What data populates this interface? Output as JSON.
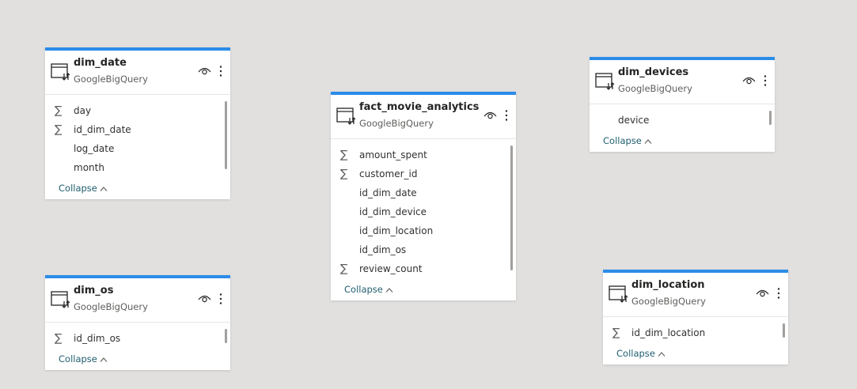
{
  "tables": {
    "dim_date": {
      "title": "dim_date",
      "source": "GoogleBigQuery",
      "collapse_label": "Collapse",
      "fields": [
        {
          "name": "day",
          "aggregate": true
        },
        {
          "name": "id_dim_date",
          "aggregate": true
        },
        {
          "name": "log_date",
          "aggregate": false
        },
        {
          "name": "month",
          "aggregate": false
        }
      ]
    },
    "fact_movie_analytics": {
      "title": "fact_movie_analytics",
      "source": "GoogleBigQuery",
      "collapse_label": "Collapse",
      "fields": [
        {
          "name": "amount_spent",
          "aggregate": true
        },
        {
          "name": "customer_id",
          "aggregate": true
        },
        {
          "name": "id_dim_date",
          "aggregate": false
        },
        {
          "name": "id_dim_device",
          "aggregate": false
        },
        {
          "name": "id_dim_location",
          "aggregate": false
        },
        {
          "name": "id_dim_os",
          "aggregate": false
        },
        {
          "name": "review_count",
          "aggregate": true
        }
      ]
    },
    "dim_devices": {
      "title": "dim_devices",
      "source": "GoogleBigQuery",
      "collapse_label": "Collapse",
      "fields": [
        {
          "name": "device",
          "aggregate": false
        }
      ]
    },
    "dim_os": {
      "title": "dim_os",
      "source": "GoogleBigQuery",
      "collapse_label": "Collapse",
      "fields": [
        {
          "name": "id_dim_os",
          "aggregate": true
        }
      ]
    },
    "dim_location": {
      "title": "dim_location",
      "source": "GoogleBigQuery",
      "collapse_label": "Collapse",
      "fields": [
        {
          "name": "id_dim_location",
          "aggregate": true
        }
      ]
    }
  },
  "icons": {
    "aggregate": "sigma",
    "table": "table-icon",
    "visibility": "eye-icon",
    "more": "more-options-icon",
    "collapse": "chevron-up-icon"
  },
  "colors": {
    "canvas": "#e1e0df",
    "card_accent": "#2b8ce8",
    "collapse_link": "#1f5e6e"
  },
  "sigma_glyph": "∑"
}
